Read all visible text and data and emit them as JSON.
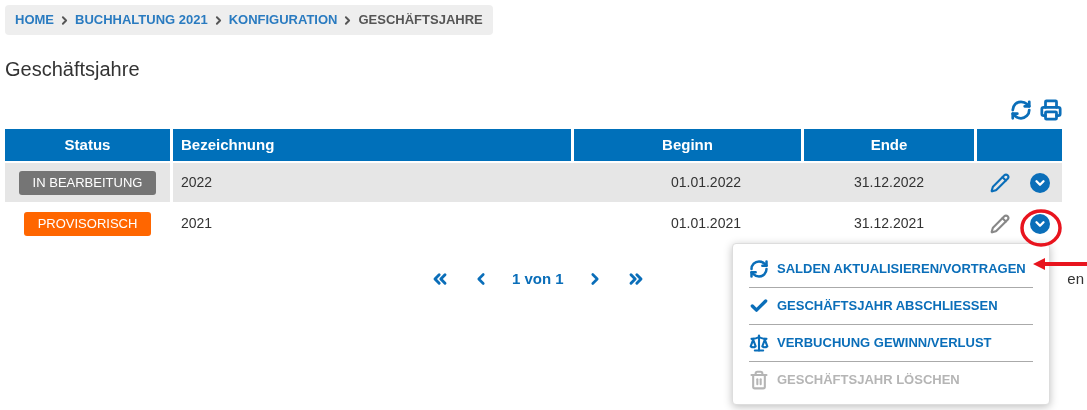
{
  "breadcrumb": [
    {
      "label": "HOME",
      "current": false
    },
    {
      "label": "BUCHHALTUNG 2021",
      "current": false
    },
    {
      "label": "KONFIGURATION",
      "current": false
    },
    {
      "label": "GESCHÄFTSJAHRE",
      "current": true
    }
  ],
  "title": "Geschäftsjahre",
  "table": {
    "columns": [
      "Status",
      "Bezeichnung",
      "Beginn",
      "Ende"
    ],
    "rows": [
      {
        "status": "IN BEARBEITUNG",
        "color": "#757575",
        "name": "2022",
        "begin": "01.01.2022",
        "end": "31.12.2022",
        "edit_active": true,
        "highlighted": true
      },
      {
        "status": "PROVISORISCH",
        "color": "#ff6600",
        "name": "2021",
        "begin": "01.01.2021",
        "end": "31.12.2021",
        "edit_active": false,
        "highlighted": false
      }
    ]
  },
  "pagination": {
    "label": "1 von 1",
    "trailing_text": "en"
  },
  "menu": [
    {
      "kind": "refresh",
      "label": "SALDEN AKTUALISIEREN/VORTRAGEN",
      "disabled": false
    },
    {
      "kind": "check",
      "label": "GESCHÄFTSJAHR ABSCHLIESSEN",
      "disabled": false
    },
    {
      "kind": "scale",
      "label": "VERBUCHUNG GEWINN/VERLUST",
      "disabled": false
    },
    {
      "kind": "trash",
      "label": "GESCHÄFTSJAHR LÖSCHEN",
      "disabled": true
    }
  ]
}
